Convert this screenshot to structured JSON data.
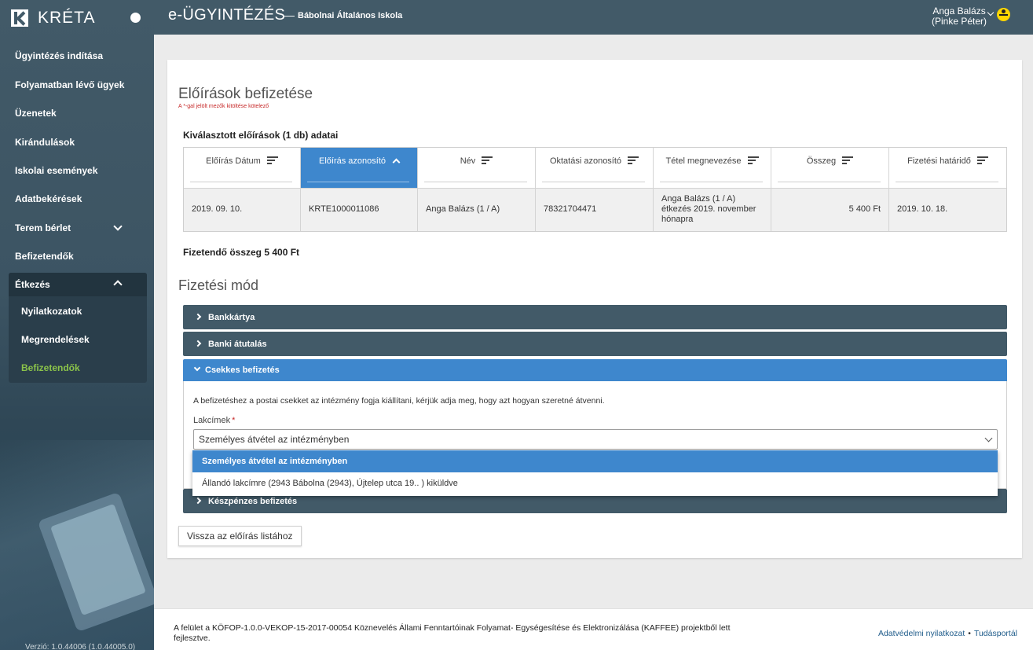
{
  "sidebar": {
    "brand": "KRÉTA",
    "items": [
      {
        "label": "Ügyintézés indítása"
      },
      {
        "label": "Folyamatban lévő ügyek"
      },
      {
        "label": "Üzenetek"
      },
      {
        "label": "Kirándulások"
      },
      {
        "label": "Iskolai események"
      },
      {
        "label": "Adatbekérések"
      },
      {
        "label": "Terem bérlet"
      },
      {
        "label": "Befizetendők"
      },
      {
        "label": "Étkezés"
      }
    ],
    "submenu": [
      {
        "label": "Nyilatkozatok"
      },
      {
        "label": "Megrendelések"
      },
      {
        "label": "Befizetendők"
      }
    ],
    "version": "Verzió: 1.0.44006 (1.0.44005.0)"
  },
  "header": {
    "title": "e-ÜGYINTÉZÉS",
    "dash": "—",
    "school": "Bábolnai Általános Iskola",
    "user_name": "Anga Balázs",
    "user_sub": "(Pinke Péter)"
  },
  "page": {
    "title": "Előírások befizetése",
    "required_note": "A *-gal jelölt mezők kitöltése kötelező",
    "selected_title": "Kiválasztott előírások (1 db) adatai",
    "total_label": "Fizetendő összeg 5 400 Ft",
    "payment_title": "Fizetési mód",
    "back_button": "Vissza az előírás listához"
  },
  "table": {
    "headers": [
      "Előírás Dátum",
      "Előírás azonosító",
      "Név",
      "Oktatási azonosító",
      "Tétel megnevezése",
      "Összeg",
      "Fizetési határidő"
    ],
    "row": [
      "2019. 09. 10.",
      "KRTE1000011086",
      "Anga Balázs (1 / A)",
      "78321704471",
      "Anga Balázs (1 / A) étkezés 2019. november hónapra",
      "5 400 Ft",
      "2019. 10. 18."
    ]
  },
  "payment": {
    "methods": [
      "Bankkártya",
      "Banki átutalás",
      "Csekkes befizetés",
      "Készpénzes befizetés"
    ],
    "check_description": "A befizetéshez a postai csekket az intézmény fogja kiállítani, kérjük adja meg, hogy azt hogyan szeretné átvenni.",
    "address_label": "Lakcímek",
    "address_required": "*",
    "address_value": "Személyes átvétel az intézményben",
    "address_options": [
      "Személyes átvétel az intézményben",
      "Állandó lakcímre (2943 Bábolna (2943), Újtelep utca 19.. ) kiküldve"
    ]
  },
  "footer": {
    "note": "A felület a KÖFOP-1.0.0-VEKOP-15-2017-00054 Köznevelés Állami Fenntartóinak Folyamat- Egységesítése és Elektronizálása (KAFFEE) projektből lett fejlesztve.",
    "link1": "Adatvédelmi nyilatkozat",
    "sep": "•",
    "link2": "Tudásportál"
  },
  "colors": {
    "header": "#425a68",
    "accent": "#3e87cd",
    "active_menu": "#8bc34a",
    "required": "#c62828"
  }
}
